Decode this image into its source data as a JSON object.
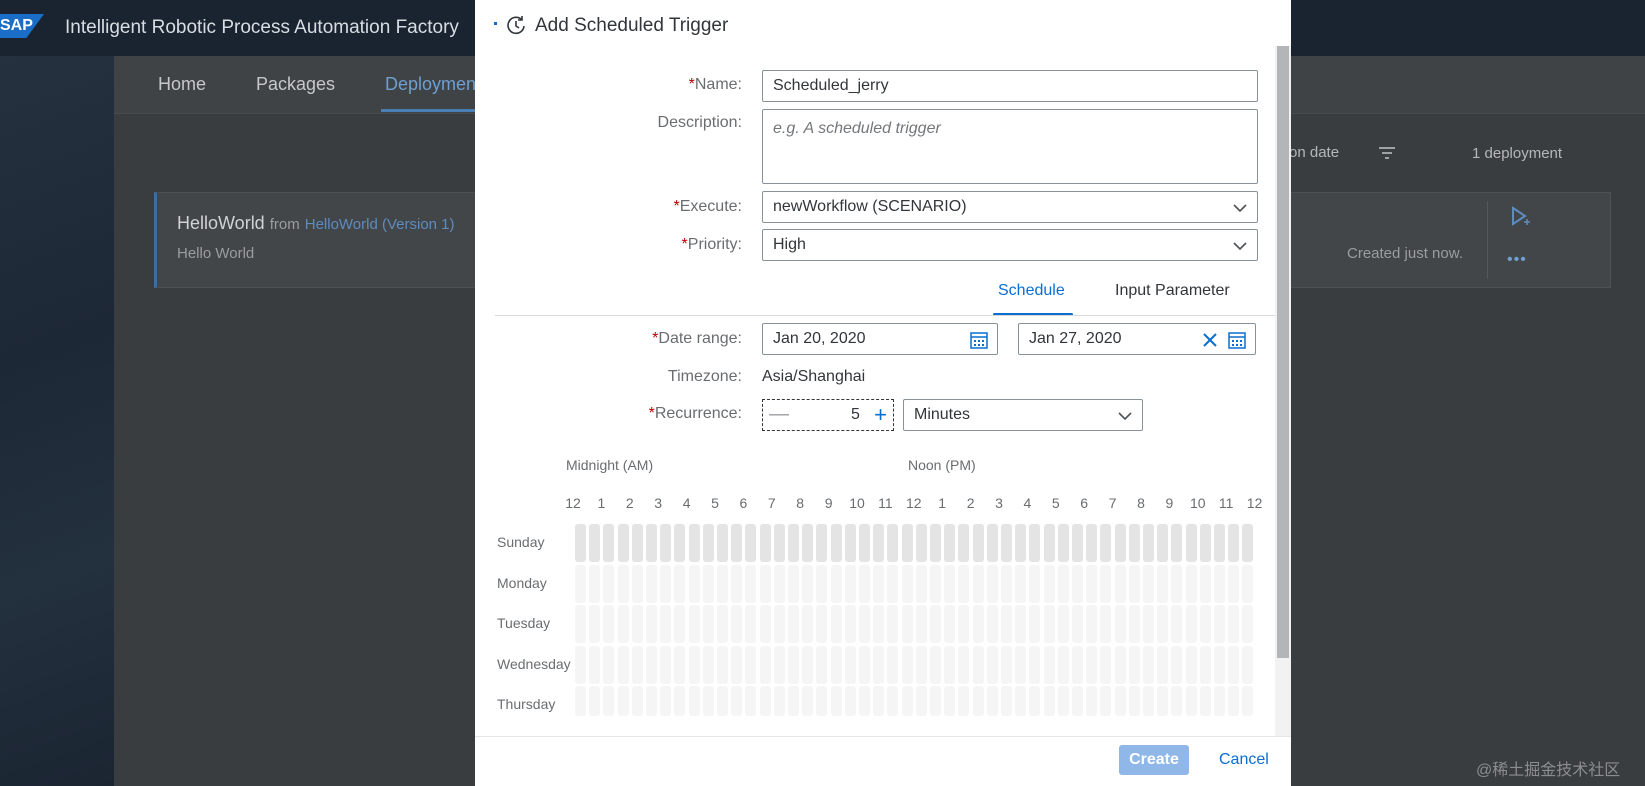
{
  "app": {
    "title": "Intelligent Robotic Process Automation Factory",
    "logo": "SAP",
    "tabs": [
      "Home",
      "Packages",
      "Deploymen"
    ],
    "sort_label": "on date",
    "count_label": "1 deployment",
    "card": {
      "name": "HelloWorld",
      "from": "from",
      "link": "HelloWorld (Version 1)",
      "desc": "Hello World",
      "created": "Created just now."
    },
    "watermark": "@稀土掘金技术社区"
  },
  "dialog": {
    "title": "Add Scheduled Trigger",
    "name_label": "Name:",
    "name_value": "Scheduled_jerry",
    "description_label": "Description:",
    "description_placeholder": "e.g.  A scheduled trigger",
    "execute_label": "Execute:",
    "execute_value": "newWorkflow (SCENARIO)",
    "priority_label": "Priority:",
    "priority_value": "High",
    "tabs": {
      "schedule": "Schedule",
      "input": "Input Parameter"
    },
    "date_range_label": "Date range:",
    "date_from": "Jan 20, 2020",
    "date_to": "Jan 27, 2020",
    "timezone_label": "Timezone:",
    "timezone_value": "Asia/Shanghai",
    "recurrence_label": "Recurrence:",
    "recurrence_value": "5",
    "recurrence_unit": "Minutes",
    "grid": {
      "am_label": "Midnight (AM)",
      "pm_label": "Noon (PM)",
      "hours": [
        "12",
        "1",
        "2",
        "3",
        "4",
        "5",
        "6",
        "7",
        "8",
        "9",
        "10",
        "11",
        "12",
        "1",
        "2",
        "3",
        "4",
        "5",
        "6",
        "7",
        "8",
        "9",
        "10",
        "11",
        "12"
      ],
      "days": [
        "Sunday",
        "Monday",
        "Tuesday",
        "Wednesday",
        "Thursday"
      ],
      "selected_day": "Sunday"
    },
    "create_label": "Create",
    "cancel_label": "Cancel"
  },
  "colors": {
    "accent": "#0a6ed1",
    "required": "#bb0000",
    "selected_cell": "#e4e4e4",
    "empty_cell": "#f5f5f5"
  }
}
